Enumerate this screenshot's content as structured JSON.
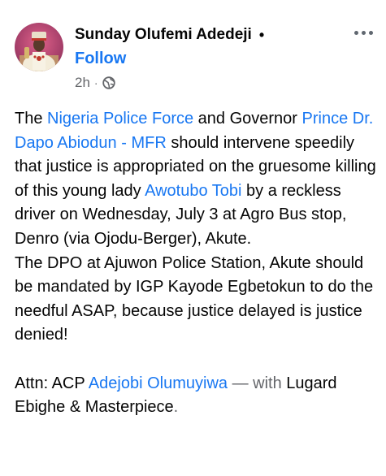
{
  "post": {
    "author": "Sunday Olufemi Adedeji",
    "separator": "•",
    "follow_label": "Follow",
    "time": "2h",
    "meta_dot": "·",
    "privacy_icon": "globe-icon",
    "more_icon": "more-options-icon"
  },
  "body": {
    "p1": {
      "t1": "The ",
      "l1": "Nigeria Police Force",
      "t2": " and Governor ",
      "l2": "Prince Dr. Dapo Abiodun - MFR",
      "t3": " should intervene speedily that justice is appropriated on the gruesome killing of this young lady ",
      "l3": "Awotubo Tobi",
      "t4": " by a reckless driver on Wednesday, July 3 at Agro Bus stop, Denro (via Ojodu-Berger), Akute."
    },
    "p2": "The DPO at Ajuwon Police Station, Akute should be mandated by IGP Kayode Egbetokun to do the needful ASAP, because justice delayed is justice denied!",
    "p3": {
      "t1": "Attn: ACP ",
      "l1": "Adejobi Olumuyiwa",
      "with": " — with ",
      "t2": "Lugard Ebighe & Masterpiece",
      "end": "."
    }
  }
}
